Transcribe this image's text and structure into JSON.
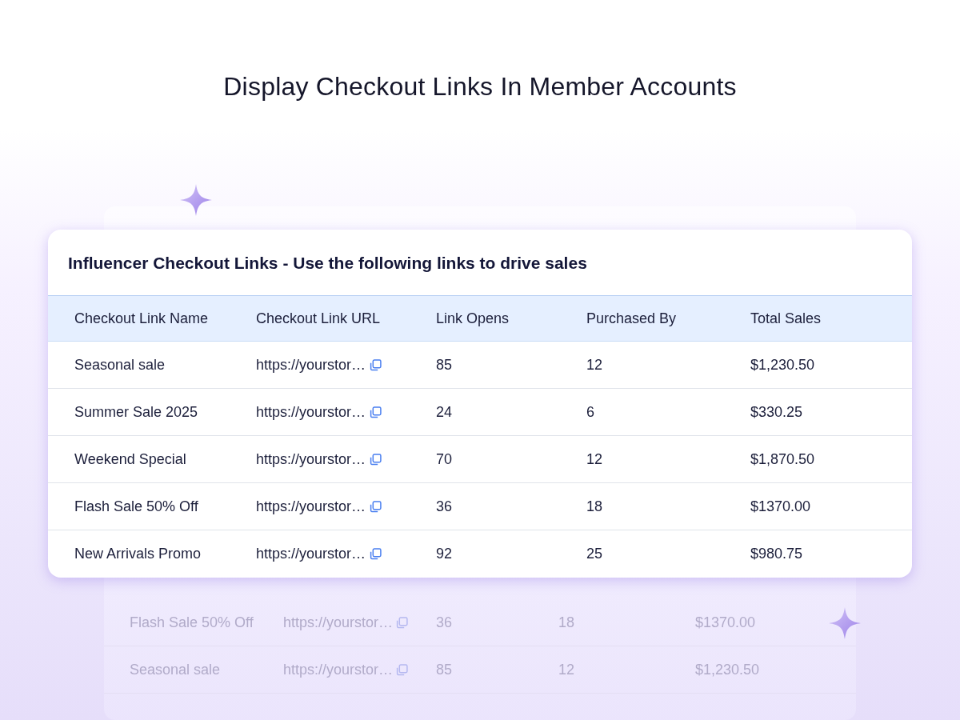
{
  "headline": "Display Checkout Links In Member Accounts",
  "back_table": {
    "rows": [
      [
        "Flash Sale 50% Off",
        "https://yourstor…",
        "36",
        "18",
        "$1370.00"
      ],
      [
        "Seasonal sale",
        "https://yourstor…",
        "85",
        "12",
        "$1,230.50"
      ]
    ]
  },
  "card": {
    "title": "Influencer Checkout Links - Use the following links to drive sales",
    "columns": [
      "Checkout Link Name",
      "Checkout Link URL",
      "Link Opens",
      "Purchased By",
      "Total Sales"
    ],
    "rows": [
      [
        "Seasonal sale",
        "https://yourstor…",
        "85",
        "12",
        "$1,230.50"
      ],
      [
        "Summer Sale 2025",
        "https://yourstor…",
        "24",
        "6",
        "$330.25"
      ],
      [
        "Weekend Special",
        "https://yourstor…",
        "70",
        "12",
        "$1,870.50"
      ],
      [
        "Flash Sale 50% Off",
        "https://yourstor…",
        "36",
        "18",
        "$1370.00"
      ],
      [
        "New Arrivals Promo",
        "https://yourstor…",
        "92",
        "25",
        "$980.75"
      ]
    ]
  }
}
